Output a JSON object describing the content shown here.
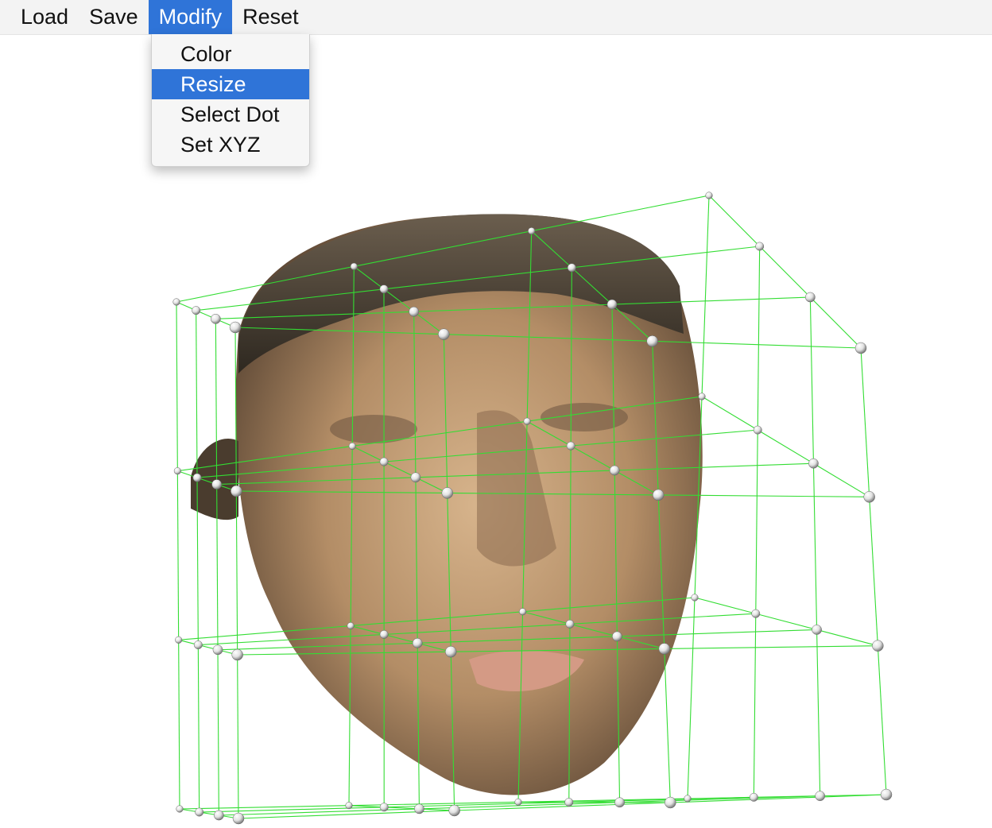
{
  "menubar": {
    "items": [
      {
        "label": "Load"
      },
      {
        "label": "Save"
      },
      {
        "label": "Modify",
        "active": true
      },
      {
        "label": "Reset"
      }
    ]
  },
  "modify_menu": {
    "items": [
      {
        "label": "Color"
      },
      {
        "label": "Resize",
        "selected": true
      },
      {
        "label": "Select Dot"
      },
      {
        "label": "Set XYZ"
      }
    ]
  },
  "colors": {
    "menubar_bg": "#f3f3f3",
    "highlight": "#2f74d8",
    "lattice_lines": "#33dd33",
    "control_points": "#eeeeee",
    "mesh_skin": "#b8926a",
    "mesh_hair": "#3e3528"
  },
  "scene": {
    "object": "face-mesh",
    "deformation_lattice": "control-point-grid",
    "control_point_icon": "sphere"
  }
}
